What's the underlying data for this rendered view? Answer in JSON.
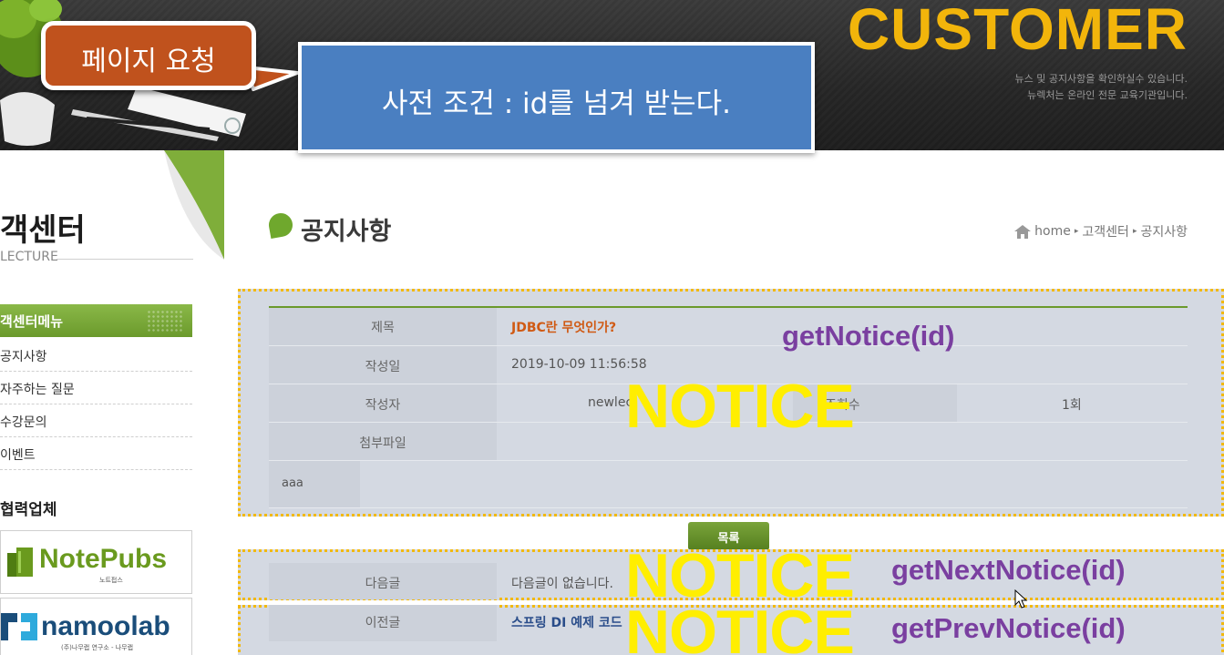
{
  "header": {
    "brand": "CUSTOMER",
    "brand_sub1": "뉴스 및 공지사항을 확인하실수 있습니다.",
    "brand_sub2": "뉴렉처는 온라인 전문 교육기관입니다."
  },
  "callouts": {
    "page_request": "페이지 요청",
    "precondition": "사전 조건 : id를 넘겨 받는다."
  },
  "sidebar": {
    "title": "객센터",
    "subtitle": "LECTURE",
    "menu_head": "객센터메뉴",
    "items": [
      {
        "label": "공지사항"
      },
      {
        "label": "자주하는 질문"
      },
      {
        "label": "수강문의"
      },
      {
        "label": "이벤트"
      }
    ],
    "partners_title": "협력업체",
    "partners": [
      {
        "name": "NotePubs",
        "sub": "노트펍스",
        "color": "#6a9a1e"
      },
      {
        "name": "namoolab",
        "sub": "(주)나무랩 연구소 - 나무랩",
        "color": "#1a4d7a"
      }
    ]
  },
  "main": {
    "page_title": "공지사항",
    "breadcrumb": [
      "home",
      "고객센터",
      "공지사항"
    ]
  },
  "notice": {
    "labels": {
      "title": "제목",
      "date": "작성일",
      "writer": "작성자",
      "views": "조회수",
      "attachment": "첨부파일"
    },
    "title": "JDBC란 무엇인가?",
    "date": "2019-10-09 11:56:58",
    "writer": "newlec",
    "views": "1회",
    "attachment": "",
    "content": "aaa"
  },
  "list_button": "목록",
  "navigation": {
    "next_label": "다음글",
    "next_value": "다음글이 없습니다.",
    "prev_label": "이전글",
    "prev_value": "스프링 DI 예제 코드"
  },
  "overlays": {
    "notice_word": "NOTICE",
    "get_notice": "getNotice(id)",
    "get_next": "getNextNotice(id)",
    "get_prev": "getPrevNotice(id)"
  },
  "colors": {
    "brand": "#f2b50b",
    "accent_green": "#6b9a2c",
    "callout_orange": "#c0521d",
    "callout_blue": "#4a7fc1",
    "overlay_yellow": "#ffee00",
    "method_purple": "#7a3fa0"
  }
}
